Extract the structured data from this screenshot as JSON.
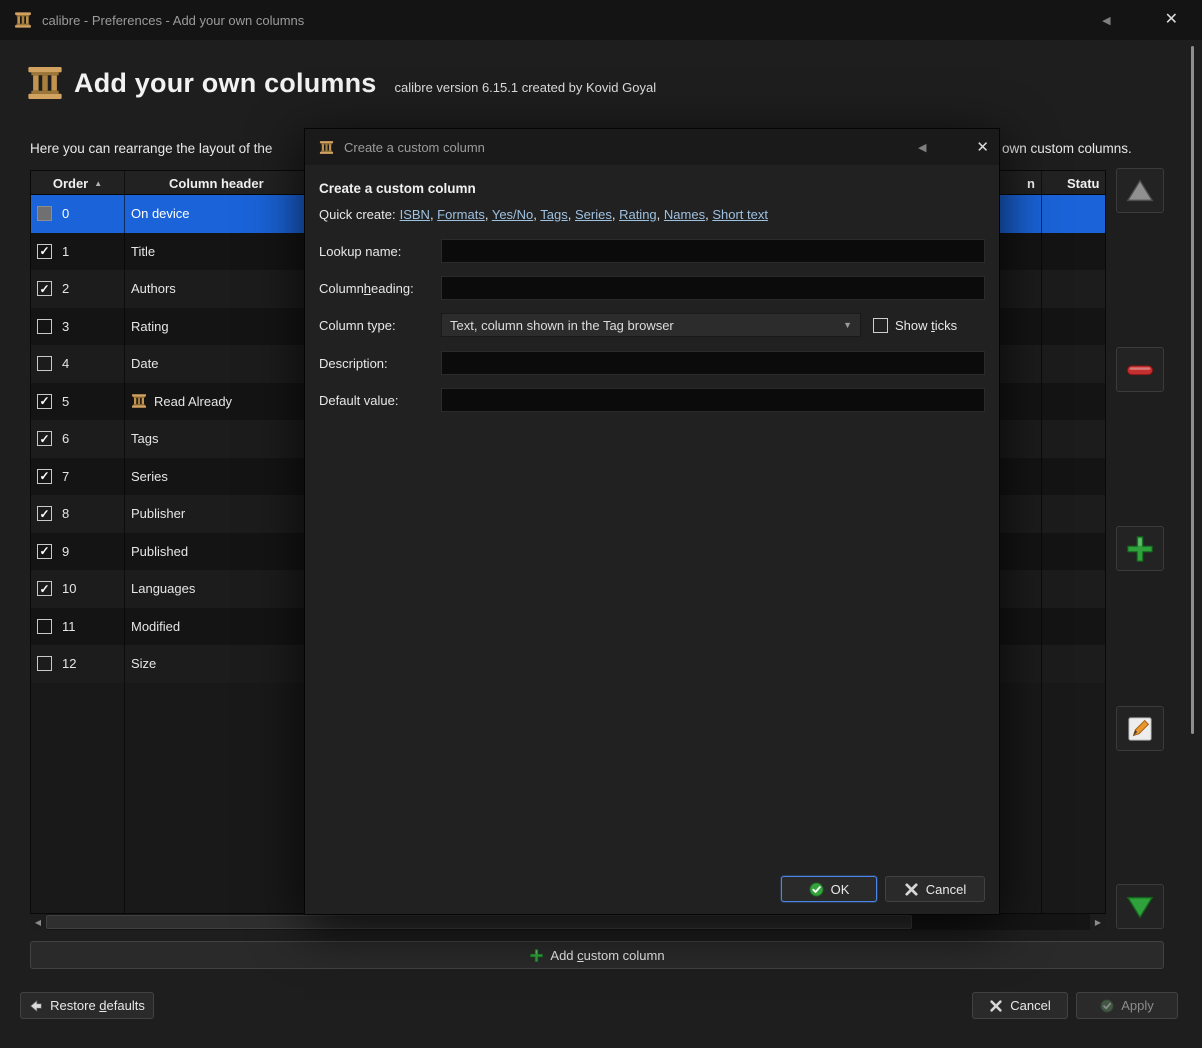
{
  "titlebar": {
    "title": "calibre - Preferences - Add your own columns",
    "back_glyph": "◀",
    "close_glyph": "✕"
  },
  "header": {
    "title": "Add your own columns",
    "subtitle": "calibre version 6.15.1 created by Kovid Goyal"
  },
  "intro": {
    "left_fragment": "Here you can rearrange the layout of the",
    "right_fragment": "own custom columns."
  },
  "table": {
    "headers": {
      "order": "Order",
      "sort_indicator": "▲",
      "column_header": "Column header",
      "partial_right_1": "n",
      "partial_right_2": "Statu"
    },
    "rows": [
      {
        "num": "0",
        "check": "disabled",
        "label": "On device",
        "selected": true
      },
      {
        "num": "1",
        "check": "checked",
        "label": "Title"
      },
      {
        "num": "2",
        "check": "checked",
        "label": "Authors"
      },
      {
        "num": "3",
        "check": "unchecked",
        "label": "Rating"
      },
      {
        "num": "4",
        "check": "unchecked",
        "label": "Date"
      },
      {
        "num": "5",
        "check": "checked",
        "label": "Read Already",
        "icon": "calibre-column"
      },
      {
        "num": "6",
        "check": "checked",
        "label": "Tags"
      },
      {
        "num": "7",
        "check": "checked",
        "label": "Series"
      },
      {
        "num": "8",
        "check": "checked",
        "label": "Publisher"
      },
      {
        "num": "9",
        "check": "checked",
        "label": "Published"
      },
      {
        "num": "10",
        "check": "checked",
        "label": "Languages"
      },
      {
        "num": "11",
        "check": "unchecked",
        "label": "Modified"
      },
      {
        "num": "12",
        "check": "unchecked",
        "label": "Size"
      }
    ]
  },
  "scrollbar": {
    "left_glyph": "◀",
    "right_glyph": "▶"
  },
  "dialog": {
    "window_title": "Create a custom column",
    "back_glyph": "◀",
    "close_glyph": "✕",
    "heading": "Create a custom column",
    "quick_create_label": "Quick create:",
    "quick_links": [
      "ISBN",
      "Formats",
      "Yes/No",
      "Tags",
      "Series",
      "Rating",
      "Names",
      "Short text"
    ],
    "lookup_label": "Lookup name:",
    "column_heading_label": {
      "pre": "Column ",
      "key": "h",
      "post": "eading:"
    },
    "column_type_label": "Column type:",
    "column_type_value": "Text, column shown in the Tag browser",
    "combo_arrow_glyph": "▼",
    "show_ticks": {
      "pre": "Show ",
      "key": "t",
      "post": "icks"
    },
    "description_label": "Description:",
    "default_value_label": "Default value:",
    "ok_label": "OK",
    "cancel_label": "Cancel"
  },
  "footer": {
    "add_custom_column": {
      "pre": "Add ",
      "key": "c",
      "post": "ustom column"
    },
    "restore_defaults": {
      "pre": "Restore ",
      "key": "d",
      "post": "efaults"
    },
    "cancel_label": "Cancel",
    "apply_label": "Apply"
  },
  "colors": {
    "selection": "#1a63d8",
    "link": "#9fc1e0",
    "ok_border": "#4a86e8",
    "green": "#2fa23b",
    "red": "#c62f2f"
  }
}
